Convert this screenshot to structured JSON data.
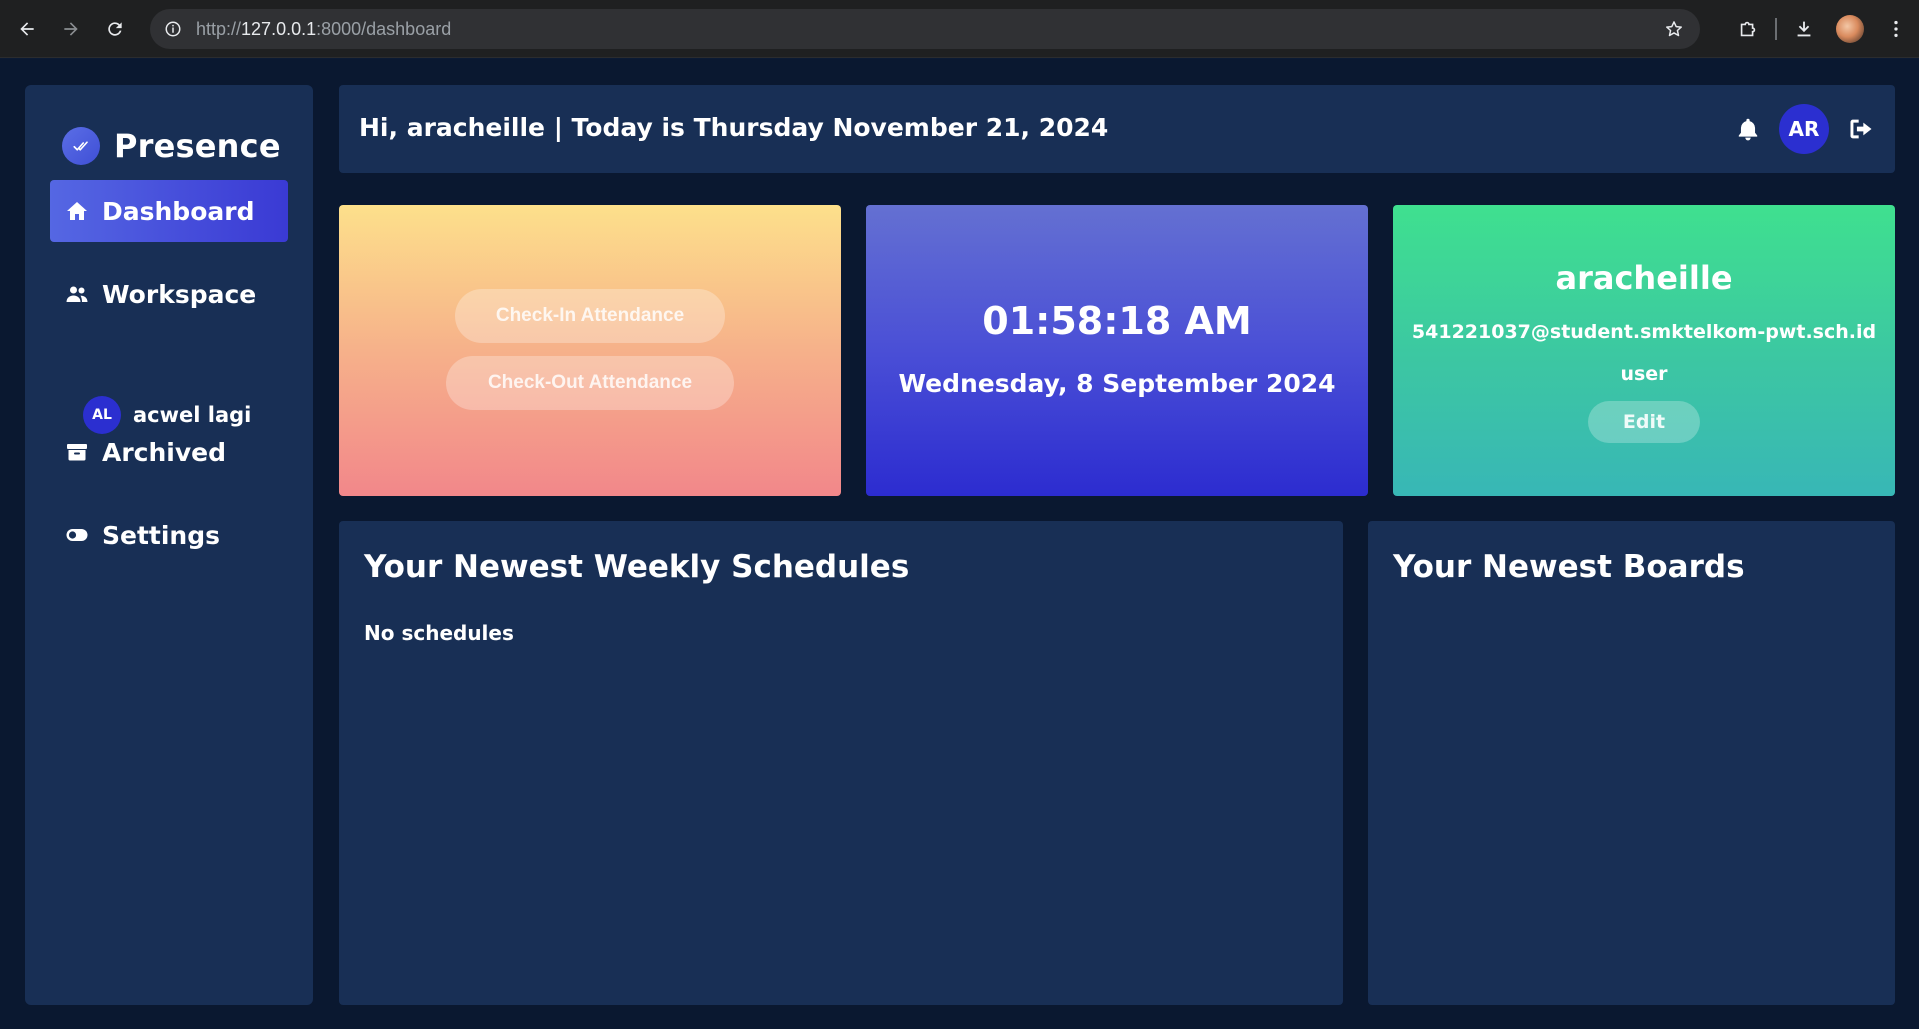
{
  "browser": {
    "url_prefix": "http://",
    "url_host": "127.0.0.1",
    "url_rest": ":8000/dashboard"
  },
  "sidebar": {
    "brand": "Presence",
    "items": [
      {
        "label": "Dashboard",
        "icon": "home-icon",
        "active": true
      },
      {
        "label": "Workspace",
        "icon": "users-icon",
        "active": false
      },
      {
        "label": "Archived",
        "icon": "archive-box-icon",
        "active": false
      },
      {
        "label": "Settings",
        "icon": "toggle-icon",
        "active": false
      }
    ],
    "workspaces": [
      {
        "initials": "AL",
        "name": "acwel lagi"
      }
    ]
  },
  "header": {
    "greeting": "Hi, aracheille | Today is Thursday November 21, 2024",
    "avatar_initials": "AR"
  },
  "attendance": {
    "checkin_label": "Check-In Attendance",
    "checkout_label": "Check-Out Attendance"
  },
  "clock": {
    "time": "01:58:18 AM",
    "date": "Wednesday, 8 September 2024"
  },
  "profile": {
    "name": "aracheille",
    "email": "541221037@student.smktelkom-pwt.sch.id",
    "role": "user",
    "edit_label": "Edit"
  },
  "schedules": {
    "title": "Your Newest Weekly Schedules",
    "empty_text": "No schedules"
  },
  "boards": {
    "title": "Your Newest Boards"
  },
  "colors": {
    "page_bg": "#0a1830",
    "panel_bg": "#182f55",
    "accent": "#2b2fd0"
  }
}
